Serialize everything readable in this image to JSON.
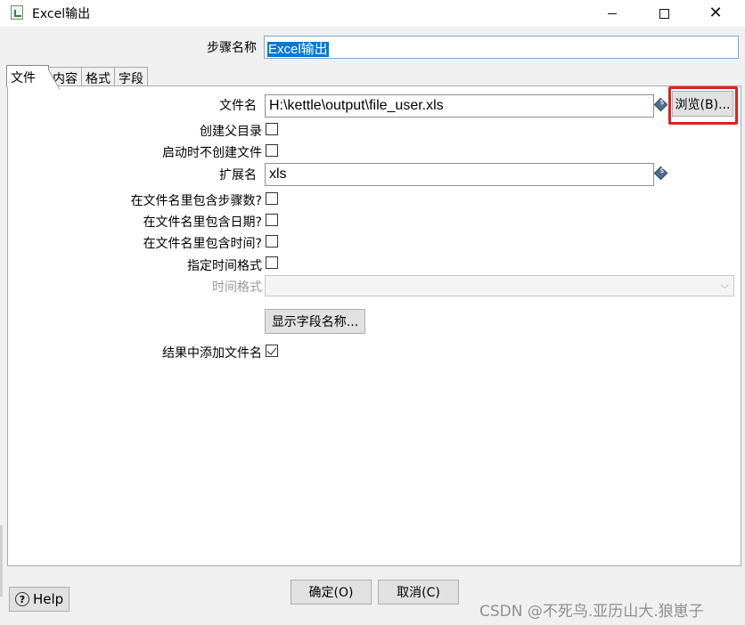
{
  "window": {
    "title": "Excel输出",
    "minimize_label": "—",
    "close_label": "✕"
  },
  "step": {
    "label": "步骤名称",
    "value": "Excel输出"
  },
  "tabs": [
    {
      "label": "文件",
      "active": true
    },
    {
      "label": "内容",
      "active": false
    },
    {
      "label": "格式",
      "active": false
    },
    {
      "label": "字段",
      "active": false
    }
  ],
  "file_tab": {
    "filename_label": "文件名",
    "filename_value": "H:\\kettle\\output\\file_user.xls",
    "browse_label": "浏览(B)...",
    "create_parent_label": "创建父目录",
    "create_parent_checked": false,
    "no_create_on_start_label": "启动时不创建文件",
    "no_create_on_start_checked": false,
    "extension_label": "扩展名",
    "extension_value": "xls",
    "include_stepnr_label": "在文件名里包含步骤数?",
    "include_stepnr_checked": false,
    "include_date_label": "在文件名里包含日期?",
    "include_date_checked": false,
    "include_time_label": "在文件名里包含时间?",
    "include_time_checked": false,
    "specify_format_label": "指定时间格式",
    "specify_format_checked": false,
    "date_format_label": "时间格式",
    "date_format_value": "",
    "show_fields_label": "显示字段名称...",
    "add_to_result_label": "结果中添加文件名",
    "add_to_result_checked": true
  },
  "footer": {
    "help_label": "Help",
    "ok_label": "确定(O)",
    "cancel_label": "取消(C)"
  },
  "watermark": "CSDN @不死鸟.亚历山大.狼崽子",
  "highlight_color": "#e02020",
  "selection_color": "#0078d7"
}
